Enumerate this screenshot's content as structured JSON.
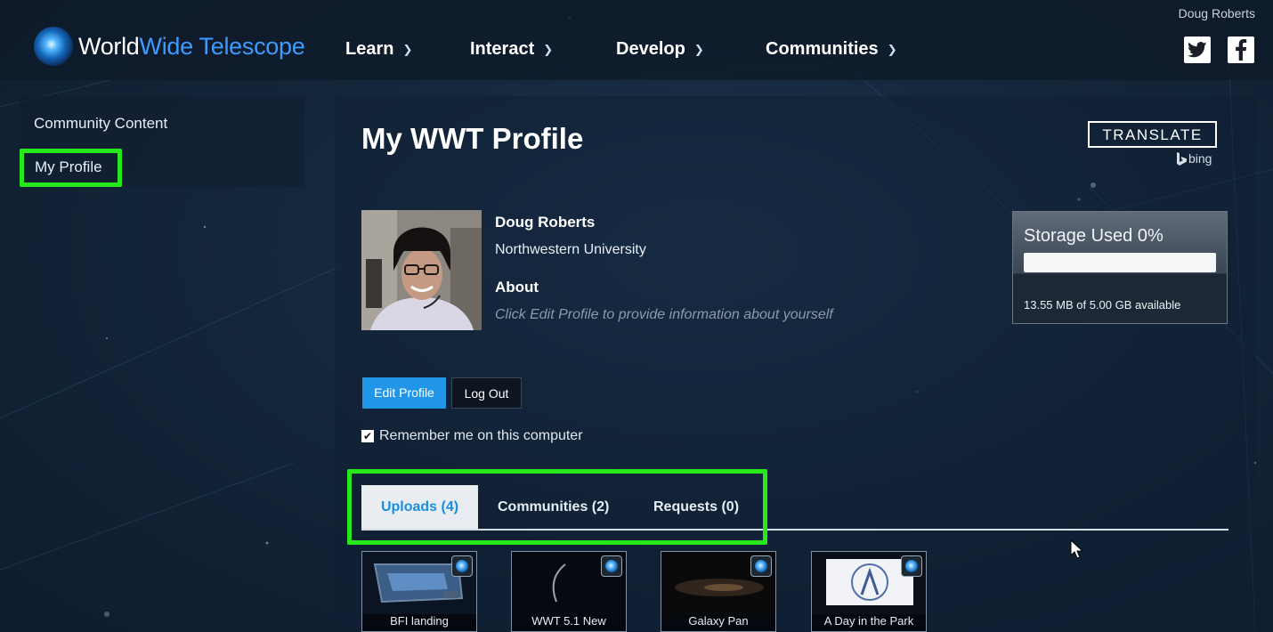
{
  "header": {
    "logo_world": "World",
    "logo_wide": "Wide Telescope",
    "nav": [
      {
        "label": "Learn"
      },
      {
        "label": "Interact"
      },
      {
        "label": "Develop"
      },
      {
        "label": "Communities"
      }
    ],
    "username": "Doug Roberts",
    "social": [
      "twitter-icon",
      "facebook-icon"
    ]
  },
  "sidebar": {
    "items": [
      {
        "label": "Community Content"
      },
      {
        "label": "My Profile"
      }
    ]
  },
  "main": {
    "title": "My WWT Profile",
    "translate_label": "TRANSLATE",
    "bing_label": "bing",
    "profile": {
      "name": "Doug Roberts",
      "organization": "Northwestern University",
      "about_heading": "About",
      "about_text": "Click Edit Profile to provide information about yourself"
    },
    "storage": {
      "title": "Storage Used 0%",
      "used_fraction": 0.0,
      "available_text": "13.55 MB of 5.00 GB available"
    },
    "buttons": {
      "edit": "Edit Profile",
      "logout": "Log Out"
    },
    "remember": {
      "label": "Remember me on this computer",
      "checked": true
    },
    "tabs": [
      {
        "label": "Uploads (4)",
        "active": true
      },
      {
        "label": "Communities (2)",
        "active": false
      },
      {
        "label": "Requests (0)",
        "active": false
      }
    ],
    "uploads": [
      {
        "label": "BFI landing"
      },
      {
        "label": "WWT 5.1 New"
      },
      {
        "label": "Galaxy Pan"
      },
      {
        "label": "A Day in the Park"
      }
    ]
  },
  "colors": {
    "accent_blue": "#2196e8",
    "highlight_green": "#26e81b",
    "logo_blue": "#3d9bff"
  }
}
